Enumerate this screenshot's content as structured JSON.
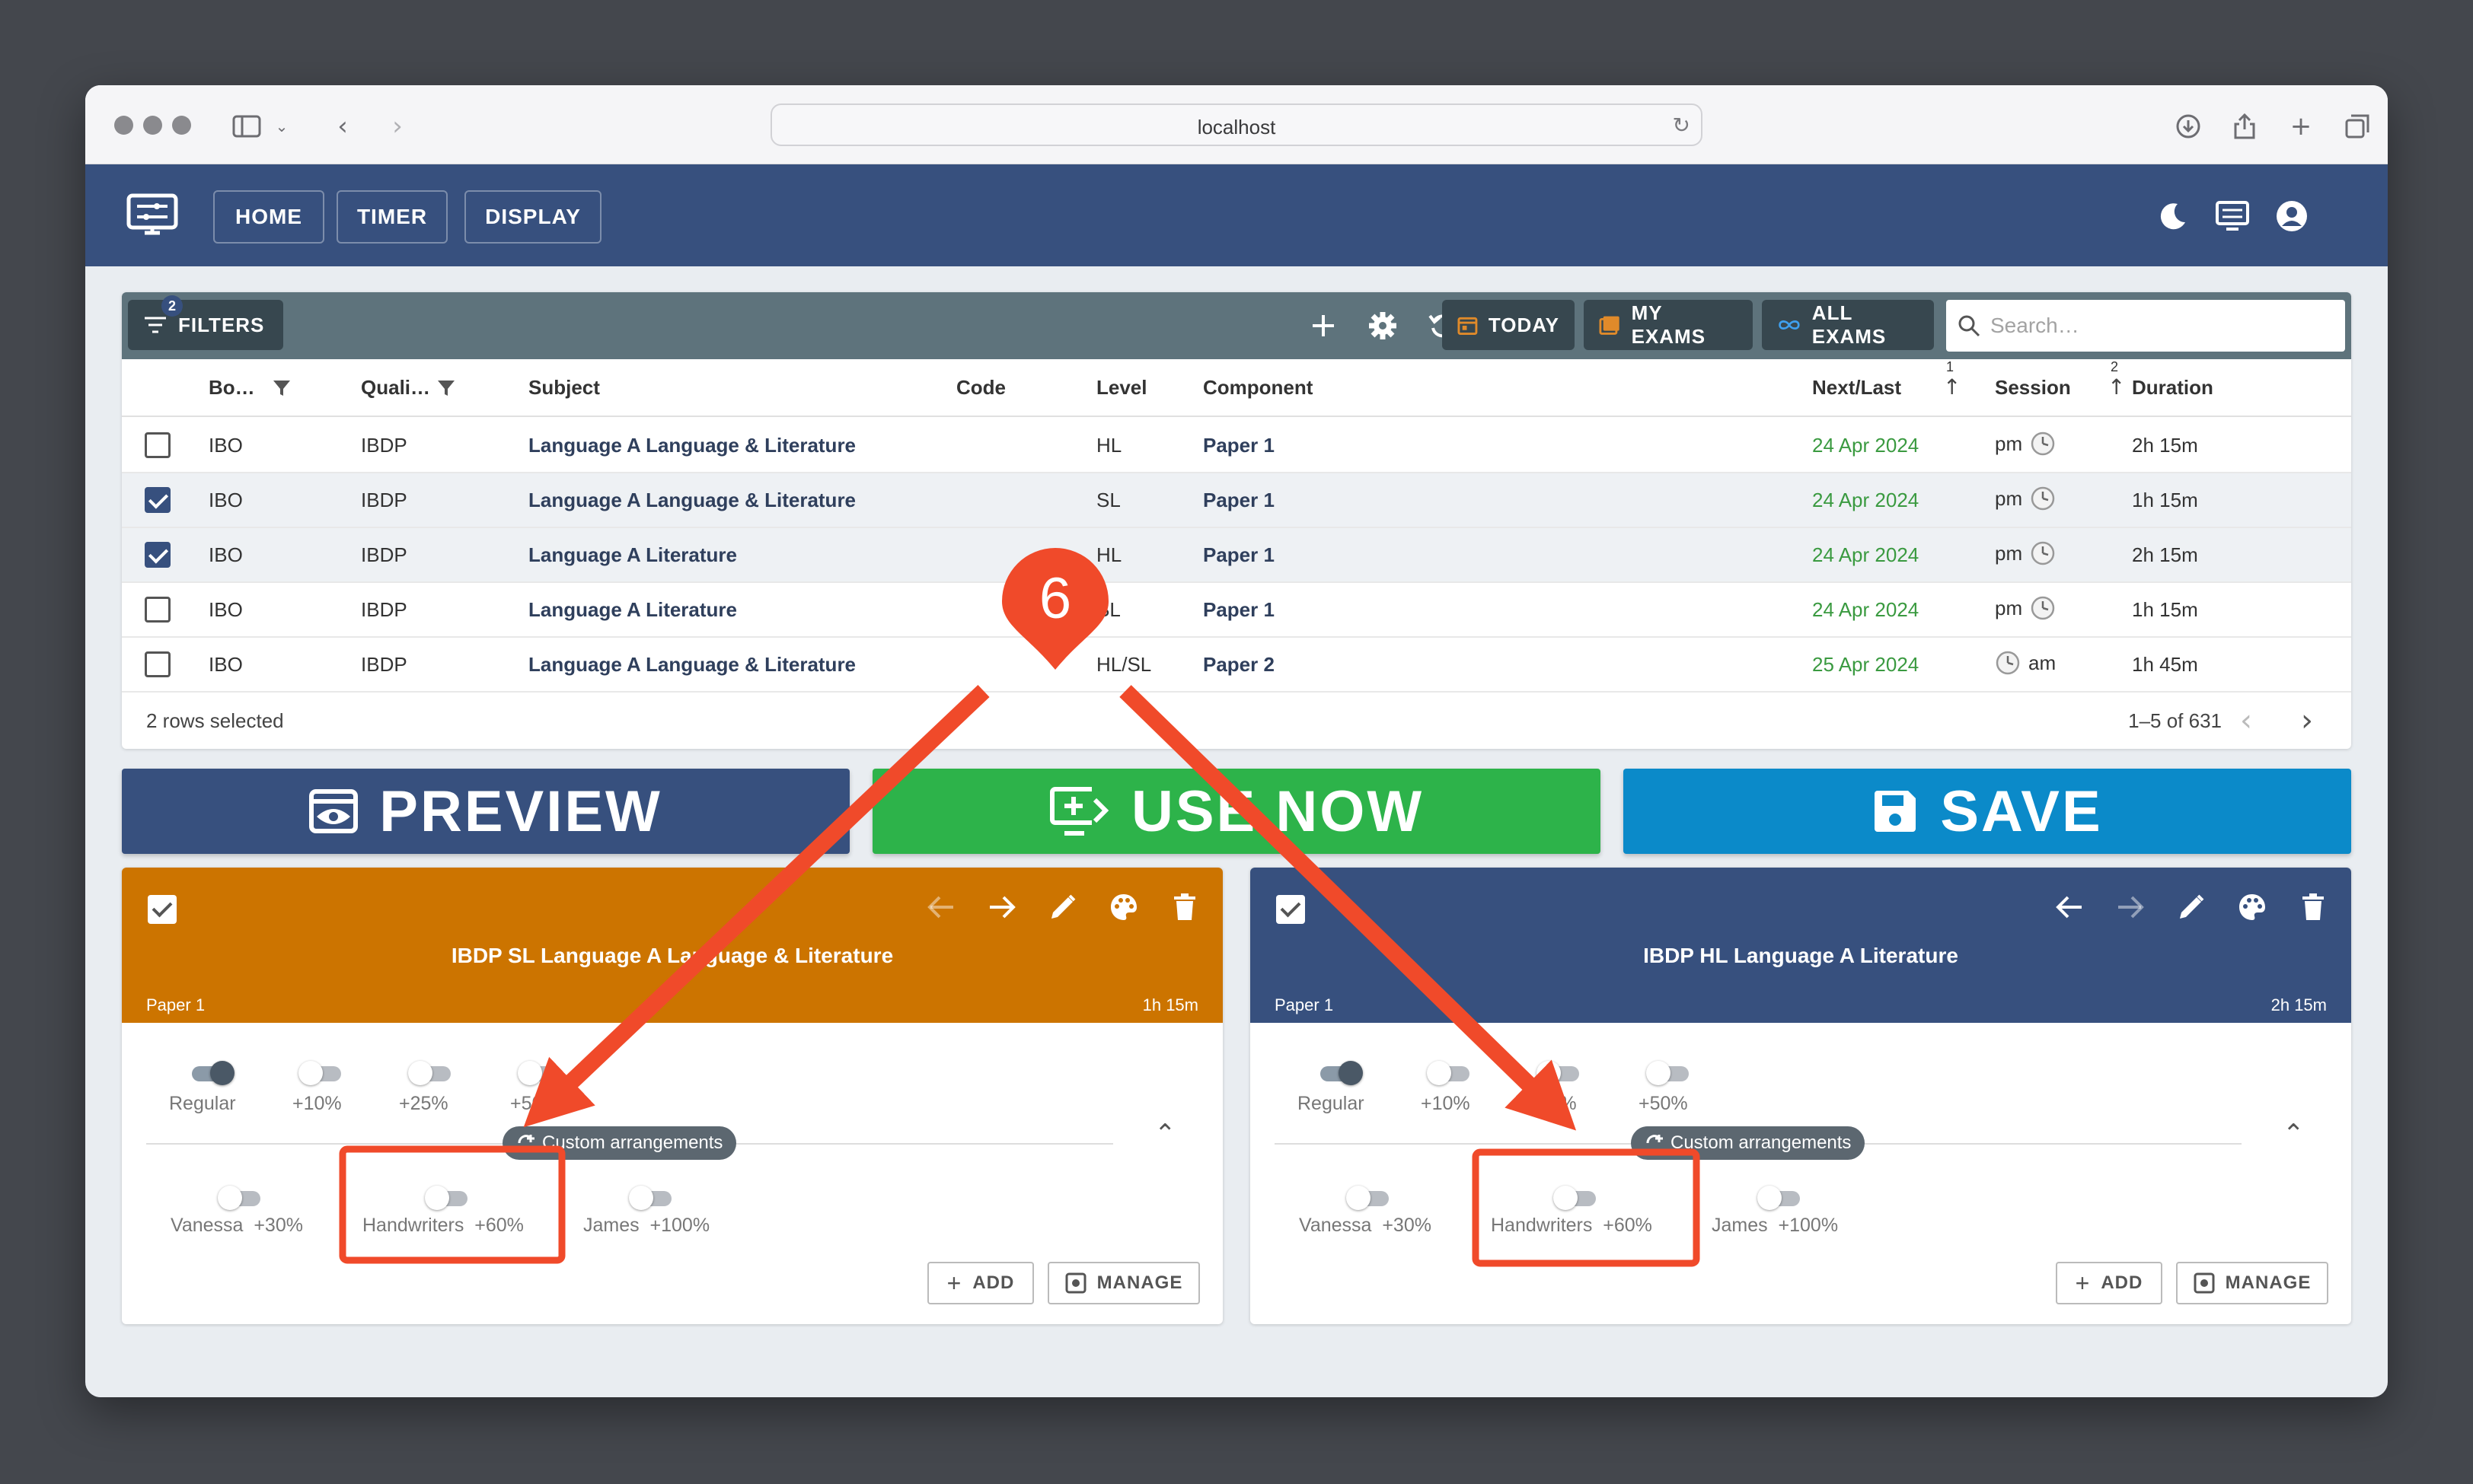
{
  "browser": {
    "url": "localhost"
  },
  "nav": {
    "home": "HOME",
    "timer": "TIMER",
    "display": "DISPLAY"
  },
  "toolbar": {
    "filters_label": "FILTERS",
    "filters_count": "2",
    "today": "TODAY",
    "my_exams": "MY EXAMS",
    "all_exams": "ALL EXAMS",
    "search_placeholder": "Search…"
  },
  "table": {
    "headers": {
      "board": "Bo…",
      "qualification": "Quali…",
      "subject": "Subject",
      "code": "Code",
      "level": "Level",
      "component": "Component",
      "next_last": "Next/Last",
      "next_last_sort": "1",
      "session": "Session",
      "session_sort": "2",
      "duration": "Duration"
    },
    "rows": [
      {
        "checked": false,
        "board": "IBO",
        "qual": "IBDP",
        "subject": "Language A Language & Literature",
        "code": "",
        "level": "HL",
        "component": "Paper 1",
        "date": "24 Apr 2024",
        "session": "pm",
        "duration": "2h 15m"
      },
      {
        "checked": true,
        "board": "IBO",
        "qual": "IBDP",
        "subject": "Language A Language & Literature",
        "code": "",
        "level": "SL",
        "component": "Paper 1",
        "date": "24 Apr 2024",
        "session": "pm",
        "duration": "1h 15m"
      },
      {
        "checked": true,
        "board": "IBO",
        "qual": "IBDP",
        "subject": "Language A Literature",
        "code": "",
        "level": "HL",
        "component": "Paper 1",
        "date": "24 Apr 2024",
        "session": "pm",
        "duration": "2h 15m"
      },
      {
        "checked": false,
        "board": "IBO",
        "qual": "IBDP",
        "subject": "Language A Literature",
        "code": "",
        "level": "SL",
        "component": "Paper 1",
        "date": "24 Apr 2024",
        "session": "pm",
        "duration": "1h 15m"
      },
      {
        "checked": false,
        "board": "IBO",
        "qual": "IBDP",
        "subject": "Language A Language & Literature",
        "code": "",
        "level": "HL/SL",
        "component": "Paper 2",
        "date": "25 Apr 2024",
        "session": "am",
        "duration": "1h 45m"
      }
    ],
    "footer_selected": "2 rows selected",
    "footer_range": "1–5 of 631"
  },
  "actions": {
    "preview": "PREVIEW",
    "use_now": "USE NOW",
    "save": "SAVE"
  },
  "cards": [
    {
      "title": "IBDP SL Language A Language & Literature",
      "component": "Paper 1",
      "duration": "1h 15m",
      "color": "#cc7400",
      "toggles": [
        "Regular",
        "+10%",
        "+25%",
        "+50%"
      ],
      "chip": "Custom arrangements",
      "custom": [
        "Vanessa  +30%",
        "Handwriters  +60%",
        "James  +100%"
      ],
      "add": "ADD",
      "manage": "MANAGE"
    },
    {
      "title": "IBDP HL Language A Literature",
      "component": "Paper 1",
      "duration": "2h 15m",
      "color": "#37507e",
      "toggles": [
        "Regular",
        "+10%",
        "+25%",
        "+50%"
      ],
      "chip": "Custom arrangements",
      "custom": [
        "Vanessa  +30%",
        "Handwriters  +60%",
        "James  +100%"
      ],
      "add": "ADD",
      "manage": "MANAGE"
    }
  ],
  "annotation": {
    "step": "6",
    "color": "#f04a2a"
  }
}
